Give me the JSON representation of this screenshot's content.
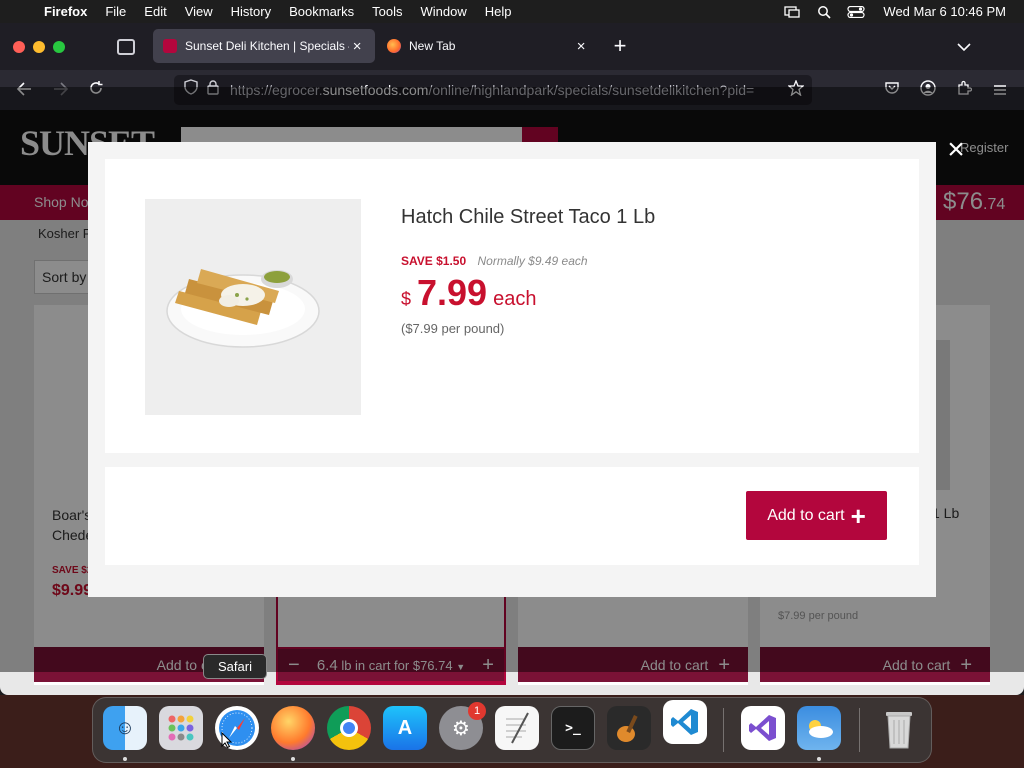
{
  "menubar": {
    "app": "Firefox",
    "items": [
      "File",
      "Edit",
      "View",
      "History",
      "Bookmarks",
      "Tools",
      "Window",
      "Help"
    ],
    "clock": "Wed Mar 6  10:46 PM"
  },
  "browser": {
    "tabs": [
      {
        "title": "Sunset Deli Kitchen | Specials – ",
        "close": "×"
      },
      {
        "title": "New Tab",
        "close": "×"
      }
    ],
    "new_tab": "+",
    "url_host_prefix": "https://egrocer.",
    "url_host": "sunsetfoods.com",
    "url_path": "/online/highlandpark/specials/sunsetdelikitchen?pid="
  },
  "site": {
    "logo": "SUNSET",
    "register": "Register",
    "nav_shop": "Shop No",
    "cart_dollars": "$76",
    "cart_cents": ".74",
    "kosher_label": "Kosher F",
    "sort_label": "Sort by",
    "bg_product_1": {
      "name_line1": "Boar's",
      "name_line2": "Chede",
      "save": "SAVE $2",
      "price": "$9.99"
    },
    "bg_product_4": {
      "name_suffix": "1 Lb",
      "per_lb": "$7.99 per pound"
    },
    "add_to_cart": "Add to cart",
    "in_cart": {
      "qty": "6.4",
      "text": "lb in cart for $76.74"
    }
  },
  "modal": {
    "close": "×",
    "product_name": "Hatch Chile Street Taco 1 Lb",
    "save": "SAVE $1.50",
    "normally": "Normally $9.49 each",
    "currency": "$",
    "price": "7.99",
    "unit": "each",
    "per_pound": "($7.99 per pound)",
    "add_button": "Add to cart"
  },
  "tooltip": "Safari",
  "dock": {
    "apps": [
      "Finder",
      "Launchpad",
      "Safari",
      "Firefox",
      "Chrome",
      "App Store",
      "System Settings",
      "TextEdit",
      "Terminal",
      "GarageBand",
      "VS Code",
      "Visual Studio",
      "Weather",
      "Trash"
    ],
    "settings_badge": "1",
    "colors": {
      "accent": "#b3063d",
      "price_red": "#c8102e"
    }
  }
}
